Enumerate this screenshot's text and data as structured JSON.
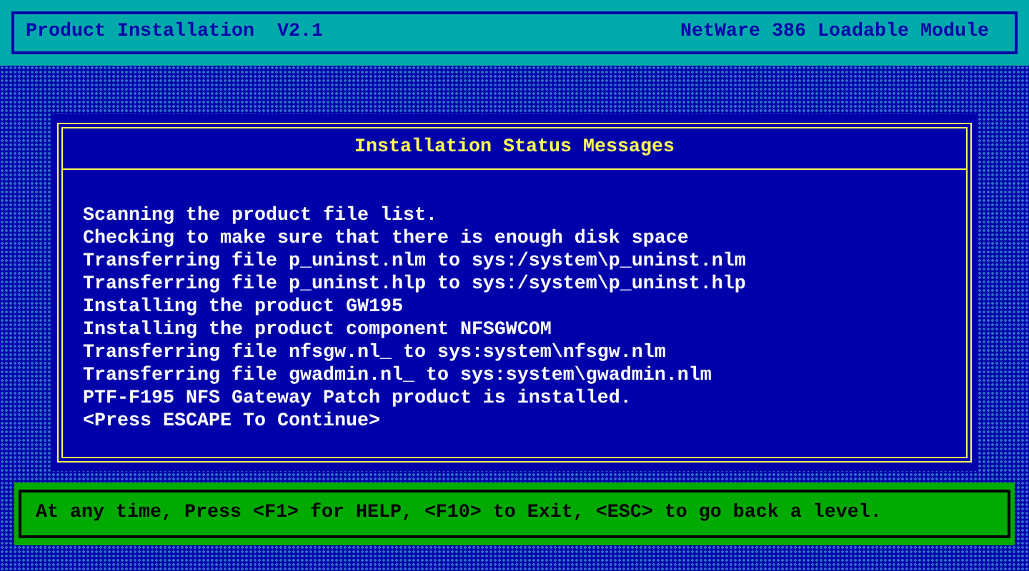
{
  "header": {
    "title": "Product Installation  V2.1",
    "module": "NetWare 386 Loadable Module"
  },
  "dialog": {
    "title": "Installation Status Messages",
    "messages": [
      "Scanning the product file list.",
      "Checking to make sure that there is enough disk space",
      "Transferring file p_uninst.nlm to sys:/system\\p_uninst.nlm",
      "Transferring file p_uninst.hlp to sys:/system\\p_uninst.hlp",
      "Installing the product GW195",
      "Installing the product component NFSGWCOM",
      "Transferring file nfsgw.nl_ to sys:system\\nfsgw.nlm",
      "Transferring file gwadmin.nl_ to sys:system\\gwadmin.nlm",
      "PTF-F195 NFS Gateway Patch product is installed.",
      "<Press ESCAPE To Continue>"
    ]
  },
  "status_bar": "At any time, Press <F1> for HELP, <F10> to Exit, <ESC> to go back a level."
}
